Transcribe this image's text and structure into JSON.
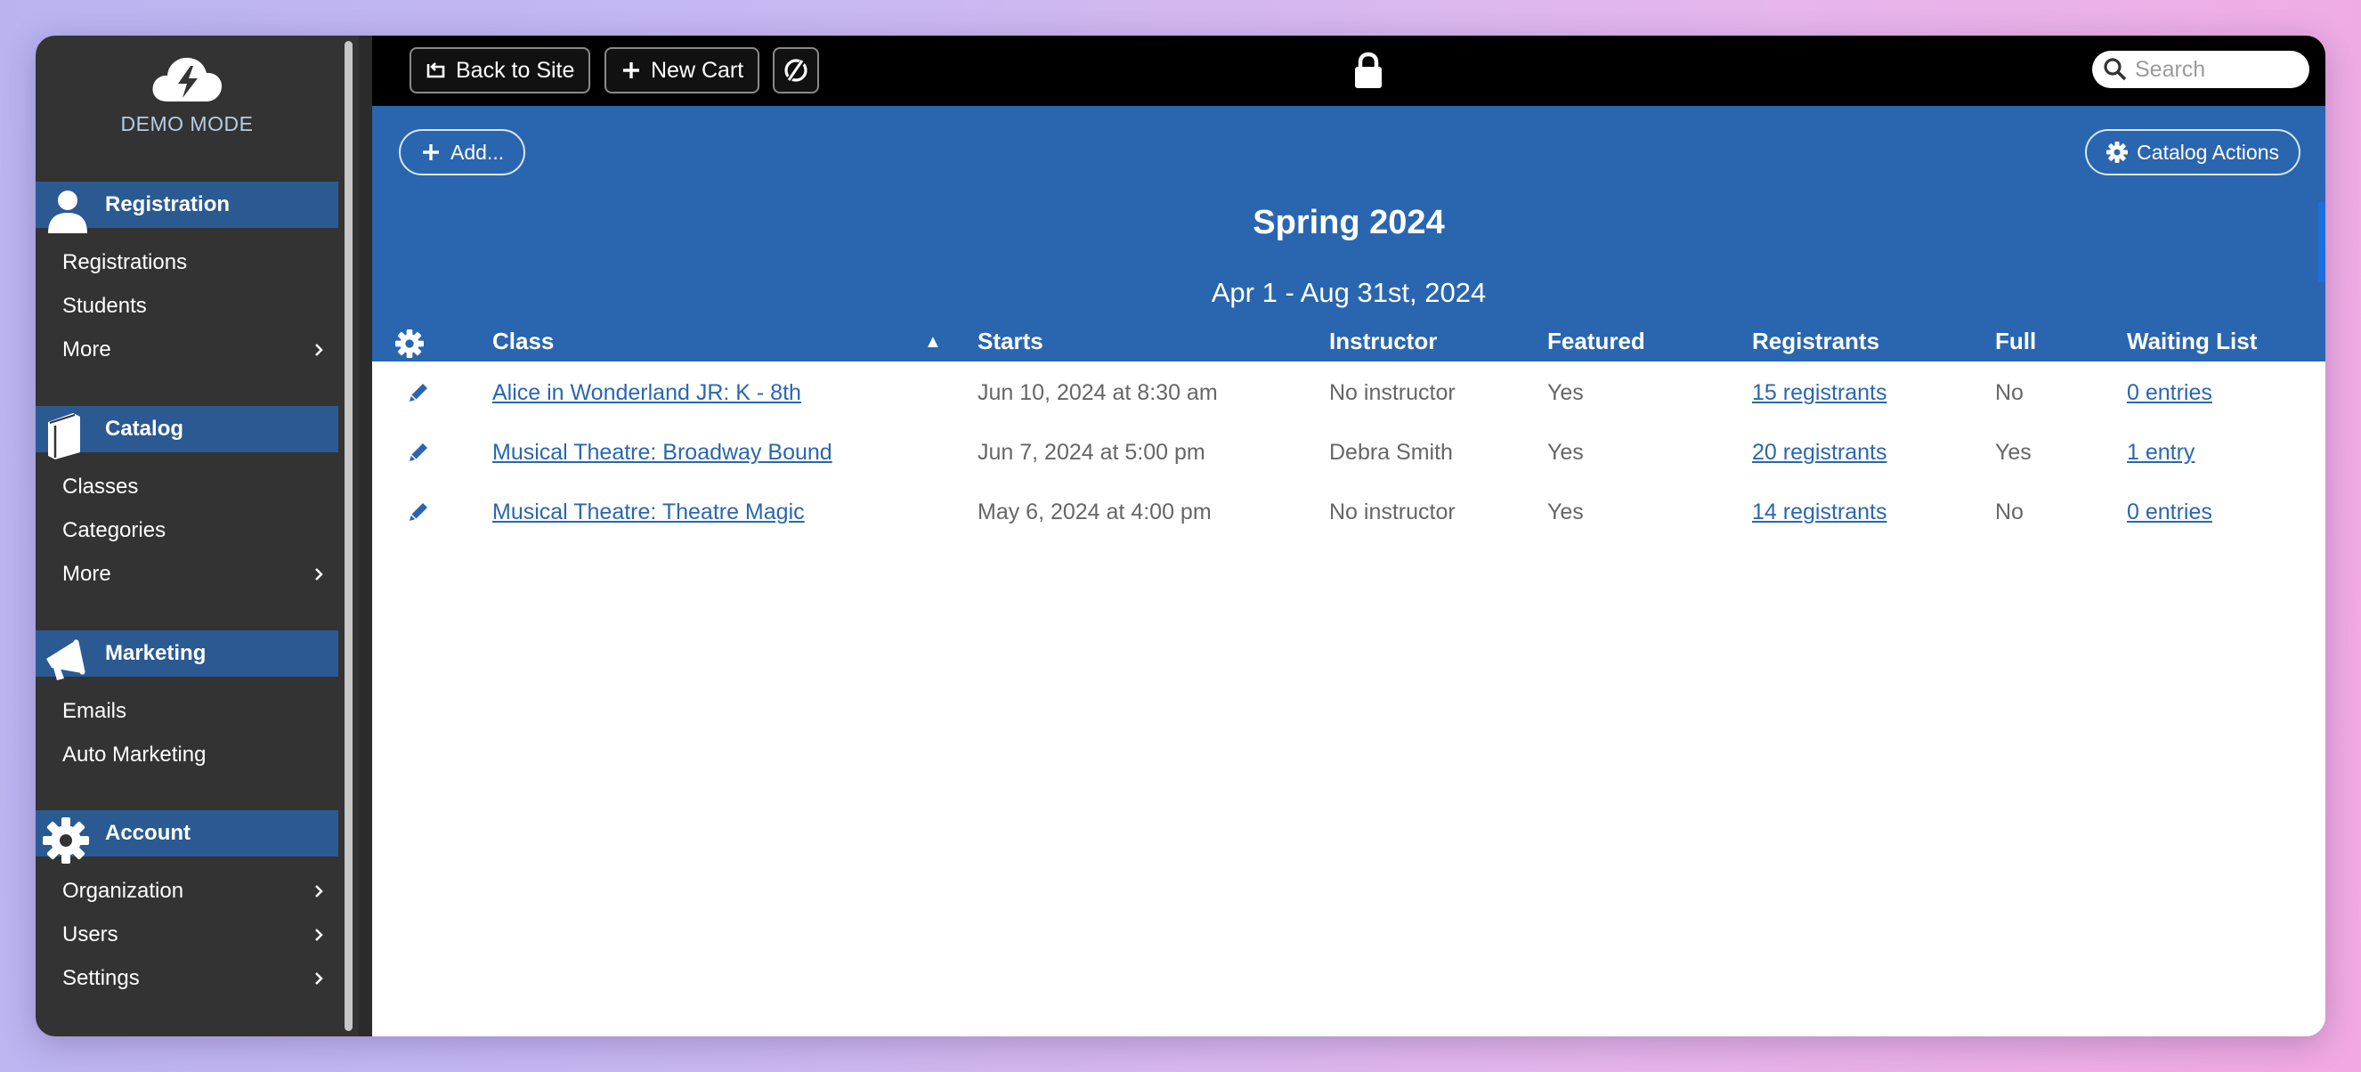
{
  "sidebar": {
    "brand_label": "DEMO MODE",
    "sections": [
      {
        "title": "Registration",
        "icon": "person-icon",
        "items": [
          {
            "label": "Registrations"
          },
          {
            "label": "Students"
          },
          {
            "label": "More",
            "has_submenu": true
          }
        ]
      },
      {
        "title": "Catalog",
        "icon": "book-icon",
        "items": [
          {
            "label": "Classes"
          },
          {
            "label": "Categories"
          },
          {
            "label": "More",
            "has_submenu": true
          }
        ]
      },
      {
        "title": "Marketing",
        "icon": "megaphone-icon",
        "items": [
          {
            "label": "Emails"
          },
          {
            "label": "Auto Marketing"
          }
        ]
      },
      {
        "title": "Account",
        "icon": "gear-icon",
        "items": [
          {
            "label": "Organization",
            "has_submenu": true
          },
          {
            "label": "Users",
            "has_submenu": true
          },
          {
            "label": "Settings",
            "has_submenu": true
          }
        ]
      }
    ]
  },
  "topbar": {
    "back_label": "Back to Site",
    "new_cart_label": "New Cart",
    "search_placeholder": "Search"
  },
  "catalog": {
    "add_label": "Add...",
    "actions_label": "Catalog Actions",
    "title": "Spring 2024",
    "dates": "Apr 1 - Aug 31st, 2024"
  },
  "table": {
    "columns": {
      "class": "Class",
      "sort_indicator": "▲",
      "starts": "Starts",
      "instructor": "Instructor",
      "featured": "Featured",
      "registrants": "Registrants",
      "full": "Full",
      "waiting_list": "Waiting List"
    },
    "rows": [
      {
        "class": "Alice in Wonderland JR: K - 8th",
        "starts": "Jun 10, 2024 at 8:30 am",
        "instructor": "No instructor",
        "featured": "Yes",
        "registrants": "15 registrants",
        "full": "No",
        "waiting_list": "0 entries"
      },
      {
        "class": "Musical Theatre: Broadway Bound",
        "starts": "Jun 7, 2024 at 5:00 pm",
        "instructor": "Debra Smith",
        "featured": "Yes",
        "registrants": "20 registrants",
        "full": "Yes",
        "waiting_list": "1 entry"
      },
      {
        "class": "Musical Theatre: Theatre Magic",
        "starts": "May 6, 2024 at 4:00 pm",
        "instructor": "No instructor",
        "featured": "Yes",
        "registrants": "14 registrants",
        "full": "No",
        "waiting_list": "0 entries"
      }
    ]
  },
  "colors": {
    "sidebar_bg": "#333333",
    "section_header": "#2b5a93",
    "accent_blue": "#2a66b0",
    "topbar_bg": "#000000"
  }
}
